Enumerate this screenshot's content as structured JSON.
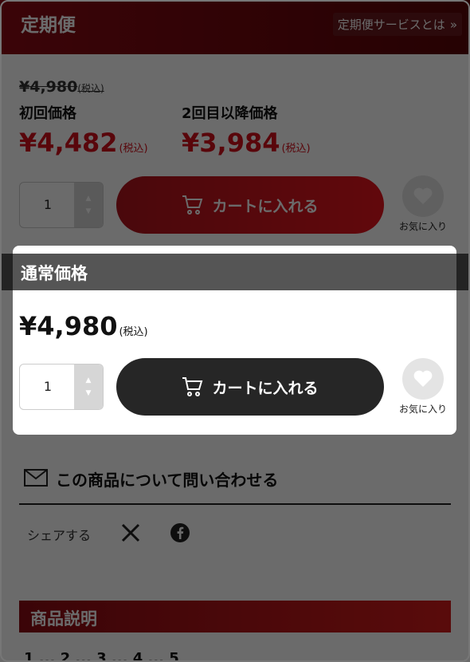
{
  "subscription": {
    "title": "定期便",
    "link_label": "定期便サービスとは",
    "link_chevron": "»",
    "original_price": "¥4,980",
    "original_tax": "(税込)",
    "first_label": "初回価格",
    "first_price": "¥4,482",
    "first_tax": "(税込)",
    "repeat_label": "2回目以降価格",
    "repeat_price": "¥3,984",
    "repeat_tax": "(税込)",
    "qty": "1",
    "cart_label": "カートに入れる",
    "fav_label": "お気に入り"
  },
  "normal": {
    "title": "通常価格",
    "price": "¥4,980",
    "tax": "(税込)",
    "qty": "1",
    "cart_label": "カートに入れる",
    "fav_label": "お気に入り"
  },
  "inquiry": {
    "label": "この商品について問い合わせる"
  },
  "share": {
    "label": "シェアする"
  },
  "description": {
    "title": "商品説明",
    "below_text": "1 ... 2 ... 3 ... 4 ... 5"
  },
  "icons": {
    "cart": "cart-icon",
    "heart": "heart-icon",
    "mail": "mail-icon",
    "x": "x-logo-icon",
    "facebook": "facebook-icon"
  },
  "colors": {
    "accent_red": "#d5101c",
    "dark_button": "#262626",
    "overlay": "rgba(0,0,0,0.58)"
  }
}
